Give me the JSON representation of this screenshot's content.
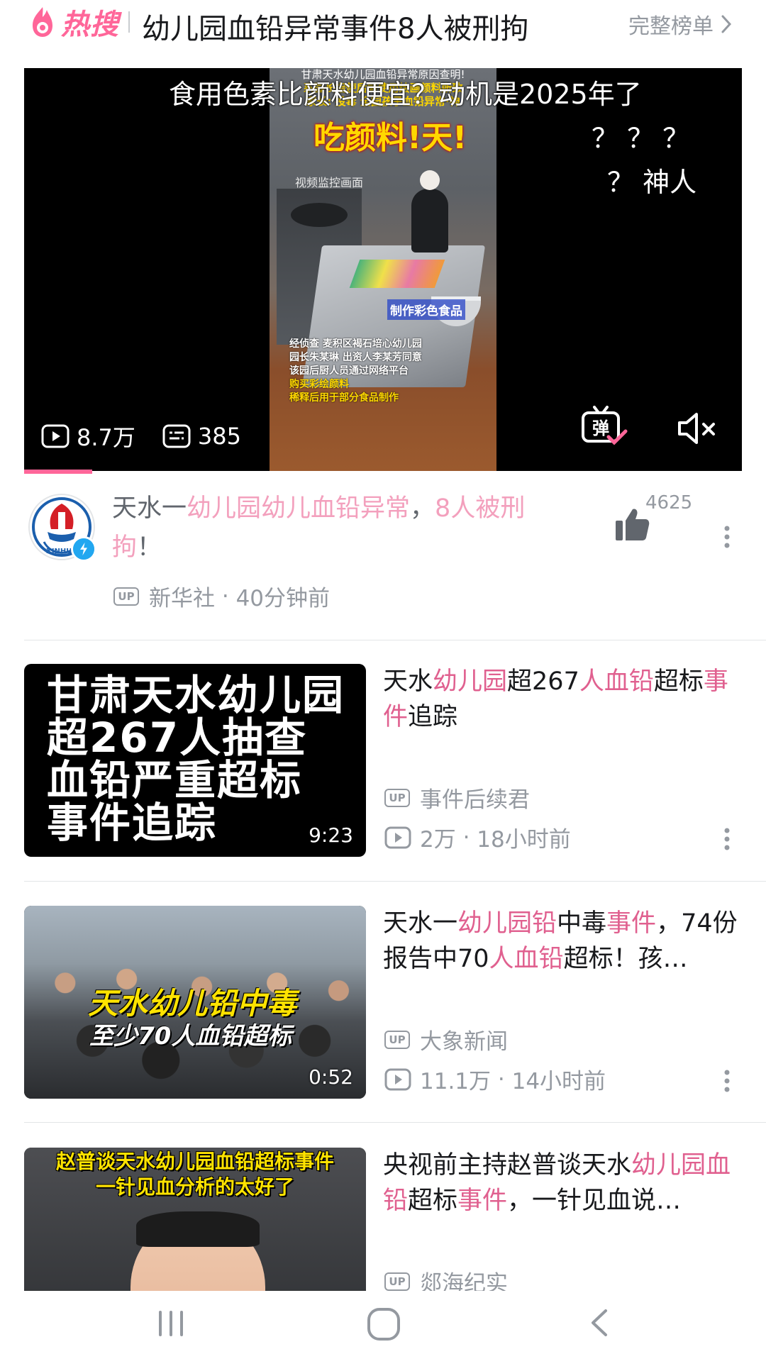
{
  "header": {
    "brand": "热搜",
    "title": "幼儿园血铅异常事件8人被刑拘",
    "full_list_label": "完整榜单"
  },
  "main_video": {
    "danmaku": [
      "食用色素比颜料便宜？动机是2025年了",
      "？ ？ ？",
      "？ 神人"
    ],
    "frame": {
      "top_small": "甘肃天水幼儿园血铅异常原因查明!",
      "top_small2": "系园长指使后厨使用绘画颜料所致",
      "top_small3": "家长: 投毒 全园孩子血铅异常·神",
      "caption": "吃颜料!天!",
      "cctv": "视频监控画面",
      "tag": "制作彩色食品",
      "notes": [
        "经侦查 麦积区褐石培心幼儿园",
        "园长朱某琳 出资人李某芳同意",
        "该园后厨人员通过网络平台",
        "购买彩绘颜料",
        "稀释后用于部分食品制作"
      ]
    },
    "views": "8.7万",
    "comments": "385",
    "progress": 0.095
  },
  "featured": {
    "title_parts": [
      {
        "text": "天水一",
        "kw": false
      },
      {
        "text": "幼儿园幼儿血铅异常",
        "kw": true
      },
      {
        "text": "，",
        "kw": false
      },
      {
        "text": "8人被刑拘",
        "kw": true
      },
      {
        "text": "！",
        "kw": false
      }
    ],
    "likes": "4625",
    "author": "新华社",
    "time": "40分钟前",
    "avatar_text": "XINHUA"
  },
  "items": [
    {
      "title_parts": [
        {
          "text": "天水",
          "kw": false
        },
        {
          "text": "幼儿园",
          "kw": true
        },
        {
          "text": "超267",
          "kw": false
        },
        {
          "text": "人血铅",
          "kw": true
        },
        {
          "text": "超标",
          "kw": false
        },
        {
          "text": "事件",
          "kw": true
        },
        {
          "text": "追踪",
          "kw": false
        }
      ],
      "author": "事件后续君",
      "views": "2万",
      "time": "18小时前",
      "duration": "9:23",
      "thumb_lines": [
        "甘肃天水幼儿园",
        "超267人抽查",
        "血铅严重超标",
        "事件追踪"
      ]
    },
    {
      "title_parts": [
        {
          "text": "天水一",
          "kw": false
        },
        {
          "text": "幼儿园铅",
          "kw": true
        },
        {
          "text": "中毒",
          "kw": false
        },
        {
          "text": "事件",
          "kw": true
        },
        {
          "text": "，74份报告中70",
          "kw": false
        },
        {
          "text": "人血铅",
          "kw": true
        },
        {
          "text": "超标！孩…",
          "kw": false
        }
      ],
      "author": "大象新闻",
      "views": "11.1万",
      "time": "14小时前",
      "duration": "0:52",
      "thumb_line1": "天水幼儿铅中毒",
      "thumb_line2": "至少70人血铅超标"
    },
    {
      "title_parts": [
        {
          "text": "央视前主持赵普谈天水",
          "kw": false
        },
        {
          "text": "幼儿园血铅",
          "kw": true
        },
        {
          "text": "超标",
          "kw": false
        },
        {
          "text": "事件",
          "kw": true
        },
        {
          "text": "，一针见血说…",
          "kw": false
        }
      ],
      "author": "郯海纪实",
      "thumb_caption": [
        "赵普谈天水幼儿园血铅超标事件",
        "一针见血分析的太好了"
      ]
    }
  ],
  "icons": {
    "brand": "hot-search-icon",
    "chevron": "chevron-right-icon",
    "play": "play-count-icon",
    "danmaku": "danmaku-count-icon",
    "danmaku_toggle": "danmaku-toggle-icon",
    "mute": "mute-icon",
    "like": "thumbs-up-icon",
    "more": "more-vertical-icon",
    "up": "up-badge-icon"
  },
  "colors": {
    "accent": "#ff6699",
    "keyword": "#e0608f",
    "keyword_light": "#f3a0bd",
    "meta": "#9499a0"
  }
}
